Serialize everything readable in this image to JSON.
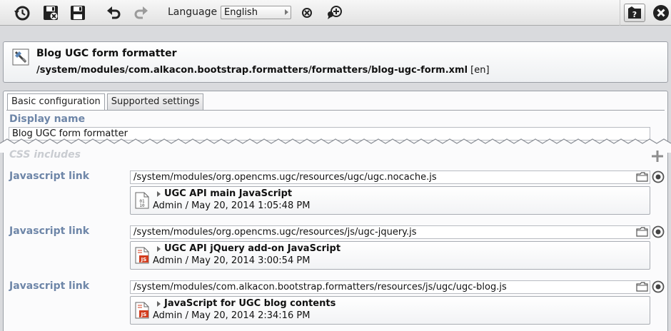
{
  "toolbar": {
    "language_label": "Language",
    "language_value": "English",
    "icons": [
      "history-icon",
      "save-exit-icon",
      "save-icon",
      "undo-icon",
      "redo-icon",
      "delete-locale-icon",
      "compare-locales-icon",
      "help-icon",
      "close-icon"
    ]
  },
  "header": {
    "title": "Blog UGC form formatter",
    "path": "/system/modules/com.alkacon.bootstrap.formatters/formatters/blog-ugc-form.xml",
    "locale": "[en]"
  },
  "tabs": [
    "Basic configuration",
    "Supported settings"
  ],
  "display_name": {
    "label": "Display name",
    "value": "Blog UGC form formatter"
  },
  "css_includes": {
    "label": "CSS includes"
  },
  "javascript_links": [
    {
      "label": "Javascript link",
      "path": "/system/modules/org.opencms.ugc/resources/ugc/ugc.nocache.js",
      "resource_title": "UGC API main JavaScript",
      "resource_meta": "Admin / May 20, 2014 1:05:48 PM",
      "file_icon": "binary-file-icon"
    },
    {
      "label": "Javascript link",
      "path": "/system/modules/org.opencms.ugc/resources/js/ugc-jquery.js",
      "resource_title": "UGC API jQuery add-on JavaScript",
      "resource_meta": "Admin / May 20, 2014 3:00:54 PM",
      "file_icon": "js-file-icon"
    },
    {
      "label": "Javascript link",
      "path": "/system/modules/com.alkacon.bootstrap.formatters/resources/js/ugc/ugc-blog.js",
      "resource_title": "JavaScript for UGC blog contents",
      "resource_meta": "Admin / May 20, 2014 2:34:16 PM",
      "file_icon": "js-file-icon"
    }
  ],
  "colors": {
    "label_blue": "#6e86a8",
    "background": "#d9dadd",
    "js_icon_red": "#d23c1e"
  }
}
